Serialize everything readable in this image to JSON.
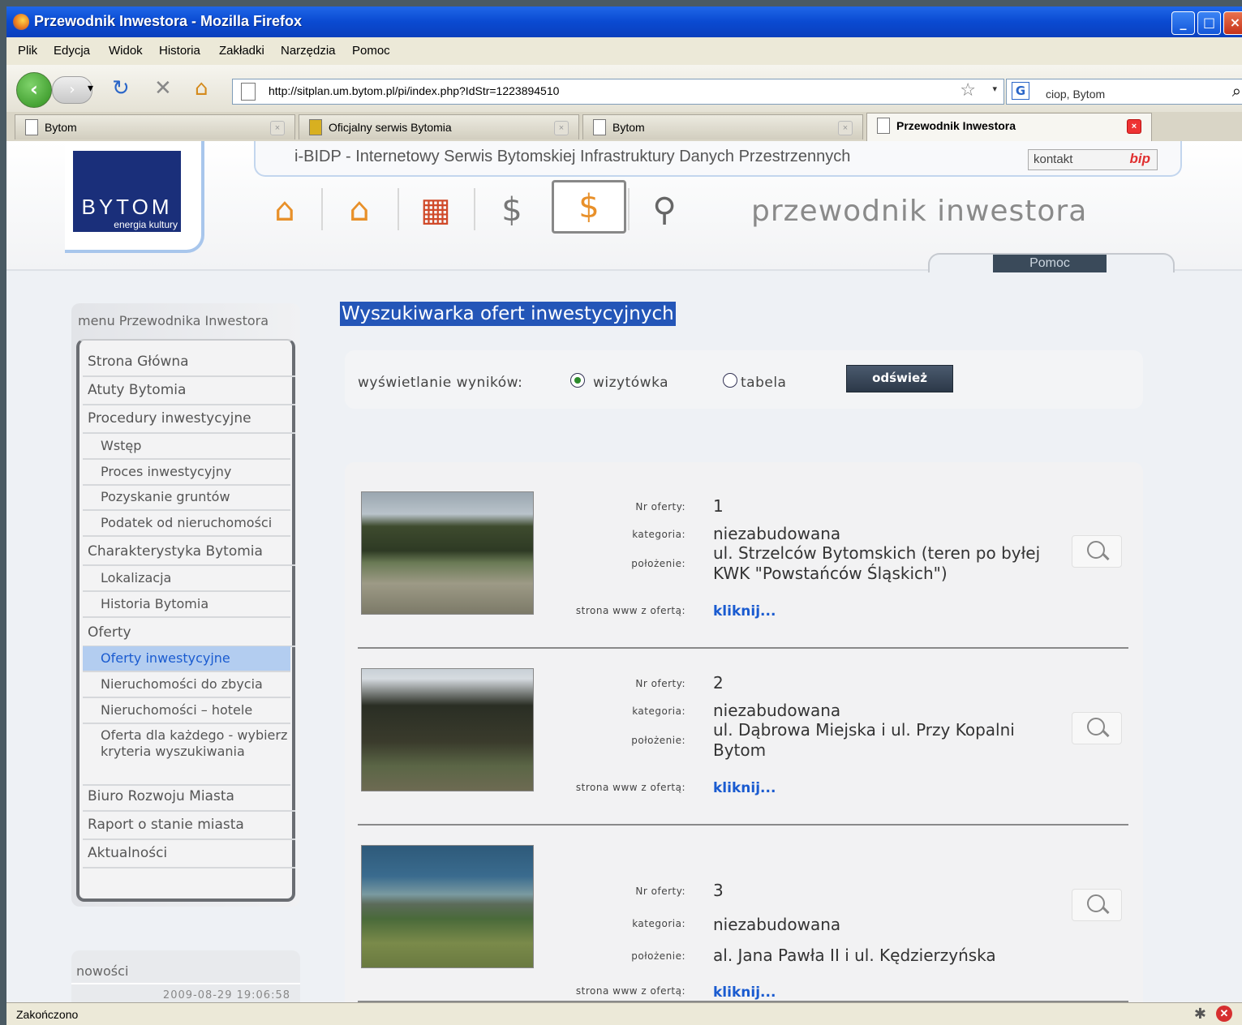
{
  "window": {
    "title": "Przewodnik Inwestora - Mozilla Firefox",
    "min": "_",
    "max": "□",
    "close": "×"
  },
  "menu": [
    "Plik",
    "Edycja",
    "Widok",
    "Historia",
    "Zakładki",
    "Narzędzia",
    "Pomoc"
  ],
  "toolbar": {
    "back": "‹",
    "forward": "›",
    "history": "▾",
    "reload": "↻",
    "stop": "✕",
    "home": "⌂",
    "url": "http://sitplan.um.bytom.pl/pi/index.php?IdStr=1223894510",
    "bookmark": "☆",
    "url_dropdown": "▾",
    "search_engine": "G",
    "search_value": "ciop, Bytom",
    "search_go": "⌕"
  },
  "tabs": [
    {
      "label": "Bytom",
      "close": "×"
    },
    {
      "label": "Oficjalny serwis Bytomia",
      "close": "×"
    },
    {
      "label": "Bytom",
      "close": "×"
    },
    {
      "label": "Przewodnik Inwestora",
      "close": "×"
    }
  ],
  "site": {
    "logo_text": "BYTOM",
    "logo_slogan": "energia kultury",
    "info_title": "i-BIDP - Internetowy Serwis Bytomskiej Infrastruktury Danych Przestrzennych",
    "kontakt": "kontakt",
    "bip": "bip",
    "brand": "przewodnik inwestora",
    "pomoc": "Pomoc",
    "icons": [
      "⌂",
      "⌂",
      "▦",
      "$",
      "$",
      "⚲"
    ]
  },
  "leftmenu": {
    "title": "menu Przewodnika Inwestora",
    "items": [
      {
        "label": "Strona Główna",
        "sub": false,
        "active": false
      },
      {
        "label": "Atuty Bytomia",
        "sub": false,
        "active": false
      },
      {
        "label": "Procedury inwestycyjne",
        "sub": false,
        "active": false
      },
      {
        "label": "Wstęp",
        "sub": true,
        "active": false
      },
      {
        "label": "Proces inwestycyjny",
        "sub": true,
        "active": false
      },
      {
        "label": "Pozyskanie gruntów",
        "sub": true,
        "active": false
      },
      {
        "label": "Podatek od nieruchomości",
        "sub": true,
        "active": false
      },
      {
        "label": "Charakterystyka Bytomia",
        "sub": false,
        "active": false
      },
      {
        "label": "Lokalizacja",
        "sub": true,
        "active": false
      },
      {
        "label": "Historia Bytomia",
        "sub": true,
        "active": false
      },
      {
        "label": "Oferty",
        "sub": false,
        "active": false
      },
      {
        "label": "Oferty inwestycyjne",
        "sub": true,
        "active": true
      },
      {
        "label": "Nieruchomości do zbycia",
        "sub": true,
        "active": false
      },
      {
        "label": "Nieruchomości – hotele",
        "sub": true,
        "active": false
      },
      {
        "label": "Oferta dla każdego - wybierz kryteria wyszukiwania",
        "sub": true,
        "active": false
      },
      {
        "label": "Biuro Rozwoju Miasta",
        "sub": false,
        "active": false
      },
      {
        "label": "Raport o stanie miasta",
        "sub": false,
        "active": false
      },
      {
        "label": "Aktualności",
        "sub": false,
        "active": false
      }
    ]
  },
  "news": {
    "title": "nowości",
    "date": "2009-08-29 19:06:58"
  },
  "main": {
    "title": "Wyszukiwarka ofert inwestycyjnych",
    "display_label": "wyświetlanie wyników:",
    "opt_card": "wizytówka",
    "opt_table": "tabela",
    "refresh": "odśwież",
    "labels": {
      "nr": "Nr oferty:",
      "kategoria": "kategoria:",
      "polozenie": "położenie:",
      "www": "strona www z ofertą:"
    },
    "offers": [
      {
        "nr": "1",
        "kategoria": "niezabudowana",
        "polozenie": "ul. Strzelców Bytomskich (teren po byłej KWK \"Powstańców Śląskich\")",
        "link": "kliknij..."
      },
      {
        "nr": "2",
        "kategoria": "niezabudowana",
        "polozenie": "ul. Dąbrowa Miejska i ul. Przy Kopalni Bytom",
        "link": "kliknij..."
      },
      {
        "nr": "3",
        "kategoria": "niezabudowana",
        "polozenie": "al. Jana Pawła II i ul. Kędzierzyńska",
        "link": "kliknij..."
      }
    ]
  },
  "status": {
    "text": "Zakończono",
    "icon1": "✱",
    "icon2": "✕"
  }
}
